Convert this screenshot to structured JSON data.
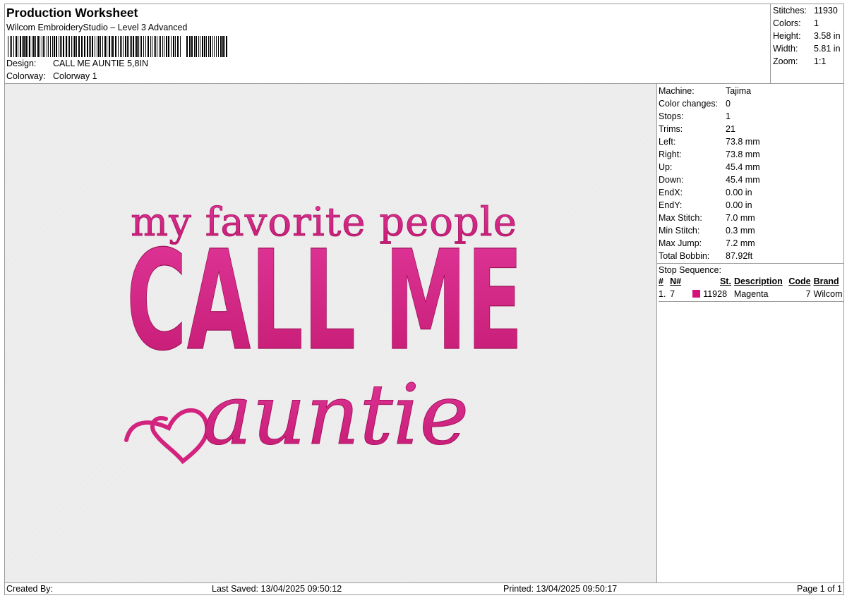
{
  "header": {
    "title": "Production Worksheet",
    "subtitle": "Wilcom EmbroideryStudio – Level 3 Advanced",
    "design_label": "Design:",
    "design_value": "CALL ME AUNTIE 5,8IN",
    "colorway_label": "Colorway:",
    "colorway_value": "Colorway 1"
  },
  "summary": [
    {
      "label": "Stitches:",
      "value": "11930"
    },
    {
      "label": "Colors:",
      "value": "1"
    },
    {
      "label": "Height:",
      "value": "3.58 in"
    },
    {
      "label": "Width:",
      "value": "5.81 in"
    },
    {
      "label": "Zoom:",
      "value": "1:1"
    }
  ],
  "machine_info": [
    {
      "label": "Machine:",
      "value": "Tajima"
    },
    {
      "label": "Color changes:",
      "value": "0"
    },
    {
      "label": "Stops:",
      "value": "1"
    },
    {
      "label": "Trims:",
      "value": "21"
    },
    {
      "label": "Left:",
      "value": "73.8 mm"
    },
    {
      "label": "Right:",
      "value": "73.8 mm"
    },
    {
      "label": "Up:",
      "value": "45.4 mm"
    },
    {
      "label": "Down:",
      "value": "45.4 mm"
    },
    {
      "label": "EndX:",
      "value": "0.00 in"
    },
    {
      "label": "EndY:",
      "value": "0.00 in"
    },
    {
      "label": "Max Stitch:",
      "value": "7.0 mm"
    },
    {
      "label": "Min Stitch:",
      "value": "0.3 mm"
    },
    {
      "label": "Max Jump:",
      "value": "7.2 mm"
    },
    {
      "label": "Total Bobbin:",
      "value": "87.92ft"
    }
  ],
  "stop_sequence": {
    "title": "Stop Sequence:",
    "headers": {
      "num": "#",
      "n": "N#",
      "st": "St.",
      "description": "Description",
      "code": "Code",
      "brand": "Brand"
    },
    "rows": [
      {
        "num": "1.",
        "n": "7",
        "color": "#d4137a",
        "st": "11928",
        "description": "Magenta",
        "code": "7",
        "brand": "Wilcom"
      }
    ]
  },
  "design": {
    "line1": "my favorite people",
    "line2": "CALL ME",
    "line3": "auntie",
    "thread_color": "#d2237f",
    "thread_dark": "#a8125f"
  },
  "footer": {
    "created_by": "Created By:",
    "last_saved": "Last Saved: 13/04/2025 09:50:12",
    "printed": "Printed: 13/04/2025 09:50:17",
    "page": "Page 1 of 1"
  }
}
